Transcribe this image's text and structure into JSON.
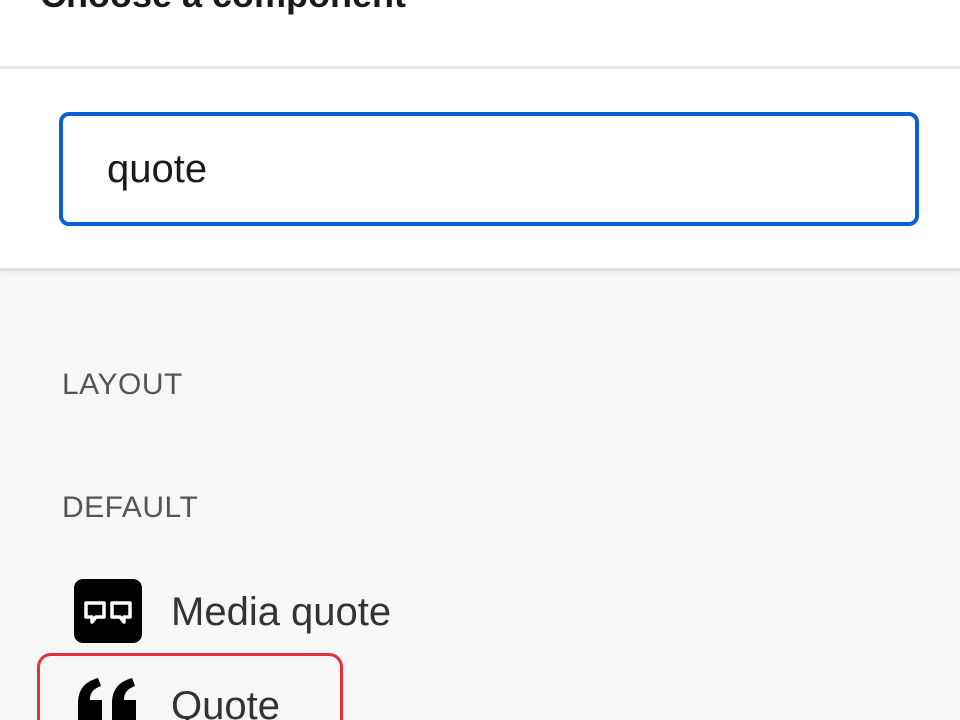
{
  "dialog": {
    "title": "Choose a component"
  },
  "search": {
    "value": "quote",
    "placeholder": ""
  },
  "sections": [
    {
      "label": "LAYOUT",
      "items": []
    },
    {
      "label": "DEFAULT",
      "items": [
        {
          "label": "Media quote",
          "icon": "media-quote-icon"
        },
        {
          "label": "Quote",
          "icon": "quote-icon"
        }
      ]
    }
  ],
  "colors": {
    "accent": "#0b5fd6",
    "highlight": "#e0323c",
    "icon_fill": "#000000"
  }
}
